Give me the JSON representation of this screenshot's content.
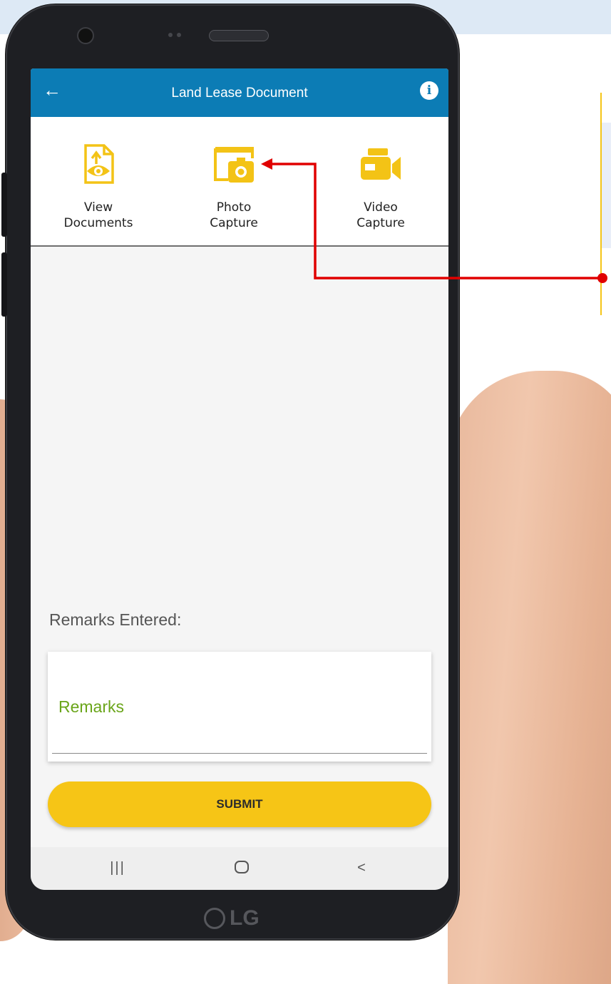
{
  "app": {
    "title": "Land Lease Document",
    "back_icon": "arrow-left-icon",
    "info_icon": "info-icon"
  },
  "actions": [
    {
      "label_line1": "View",
      "label_line2": "Documents",
      "icon": "view-documents-icon"
    },
    {
      "label_line1": "Photo",
      "label_line2": "Capture",
      "icon": "photo-capture-icon"
    },
    {
      "label_line1": "Video",
      "label_line2": "Capture",
      "icon": "video-capture-icon"
    }
  ],
  "remarks": {
    "heading": "Remarks Entered:",
    "field_label": "Remarks"
  },
  "submit_label": "SUBMIT",
  "nav": {
    "recent": "|||",
    "home": "○",
    "back": "<"
  },
  "device": {
    "brand": "LG"
  },
  "colors": {
    "app_bar": "#0c7cb5",
    "accent_yellow": "#f6c516",
    "field_label_green": "#6aa51a",
    "annotation_red": "#e00000"
  }
}
